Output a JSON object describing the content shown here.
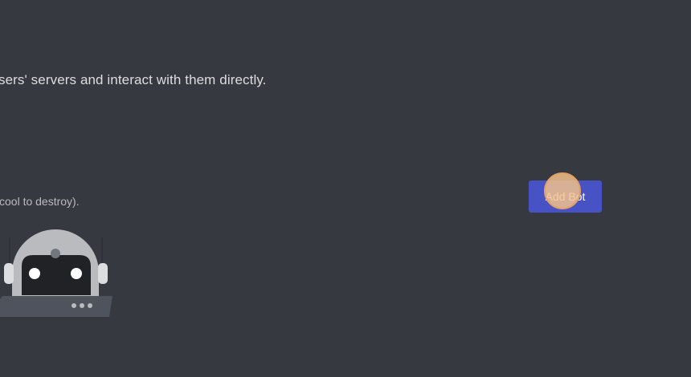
{
  "page": {
    "description": "sers' servers and interact with them directly.",
    "warning_note": "cool to destroy).",
    "add_bot_button": {
      "label": "Add Bot",
      "color": "#4752c4"
    },
    "background_color": "#36393f",
    "illustration": {
      "icon": "robot-icon"
    }
  }
}
